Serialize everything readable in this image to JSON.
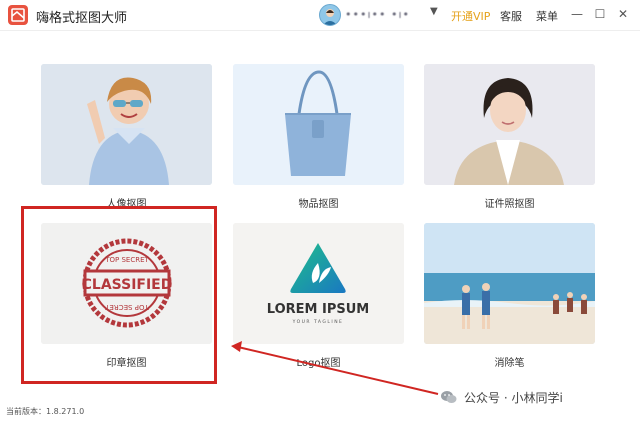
{
  "app": {
    "title": "嗨格式抠图大师",
    "username": "•••ı•• •ı•",
    "vip_label": "开通VIP",
    "service_label": "客服",
    "menu_label": "菜单",
    "accent_color": "#e8523f",
    "vip_color": "#e5a21c"
  },
  "window_controls": {
    "minimize": "—",
    "maximize": "☐",
    "close": "✕"
  },
  "cards": [
    {
      "label": "人像抠图",
      "icon": "portrait-thumbnail"
    },
    {
      "label": "物品抠图",
      "icon": "handbag-thumbnail"
    },
    {
      "label": "证件照抠图",
      "icon": "id-photo-thumbnail"
    },
    {
      "label": "印章抠图",
      "icon": "stamp-thumbnail",
      "stamp_top": "TOP SECRET",
      "stamp_center": "CLASSIFIED",
      "stamp_bottom": "TOP SECRET"
    },
    {
      "label": "Logo抠图",
      "icon": "logo-thumbnail",
      "logo_main": "LOREM IPSUM",
      "logo_sub": "YOUR TAGLINE"
    },
    {
      "label": "消除笔",
      "icon": "beach-thumbnail"
    }
  ],
  "annotation": {
    "highlight_color": "#d02622"
  },
  "footer": {
    "version_label": "当前版本：1.8.271.0"
  },
  "watermark": {
    "text": "公众号 · 小林同学i"
  }
}
